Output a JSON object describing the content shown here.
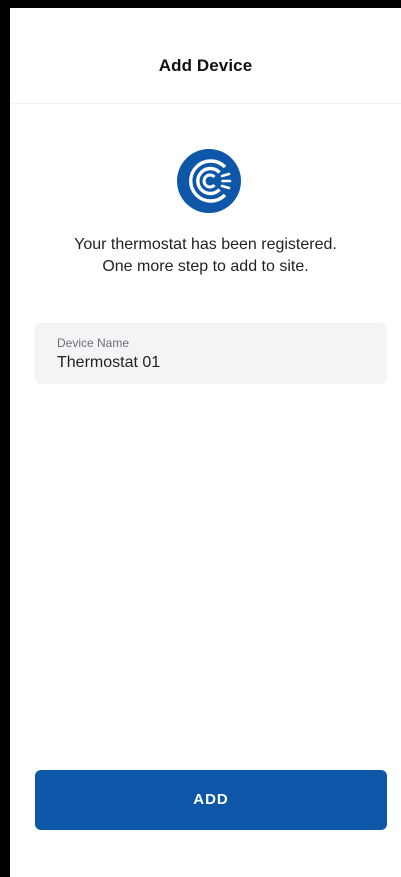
{
  "header": {
    "title": "Add Device"
  },
  "logo": {
    "icon": "connected-c-logo-icon",
    "color": "#0e57a8"
  },
  "message": {
    "line1": "Your thermostat has been registered.",
    "line2": "One more step to add to site."
  },
  "device_name_field": {
    "label": "Device Name",
    "value": "Thermostat 01"
  },
  "add_button": {
    "label": "ADD",
    "color": "#0e57a8"
  }
}
